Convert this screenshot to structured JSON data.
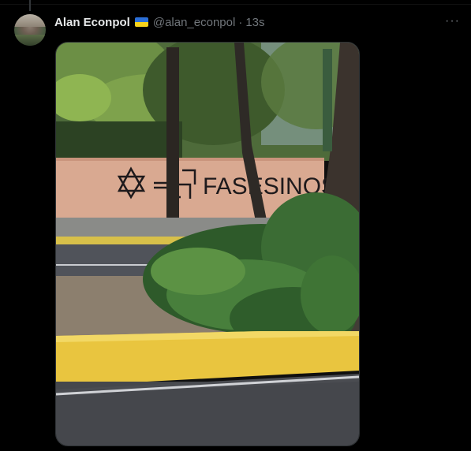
{
  "post": {
    "author_name": "Alan Econpol",
    "handle": "@alan_econpol",
    "separator": "·",
    "time_ago": "13s",
    "more_label": "···"
  },
  "image": {
    "graffiti_text": "FASESINOS"
  },
  "icons": {
    "flag": "ukraine-flag-icon",
    "more": "more-horizontal-icon"
  },
  "colors": {
    "background": "#000000",
    "name": "#e7e9ea",
    "secondary": "#71767b",
    "border": "#2f3336"
  }
}
